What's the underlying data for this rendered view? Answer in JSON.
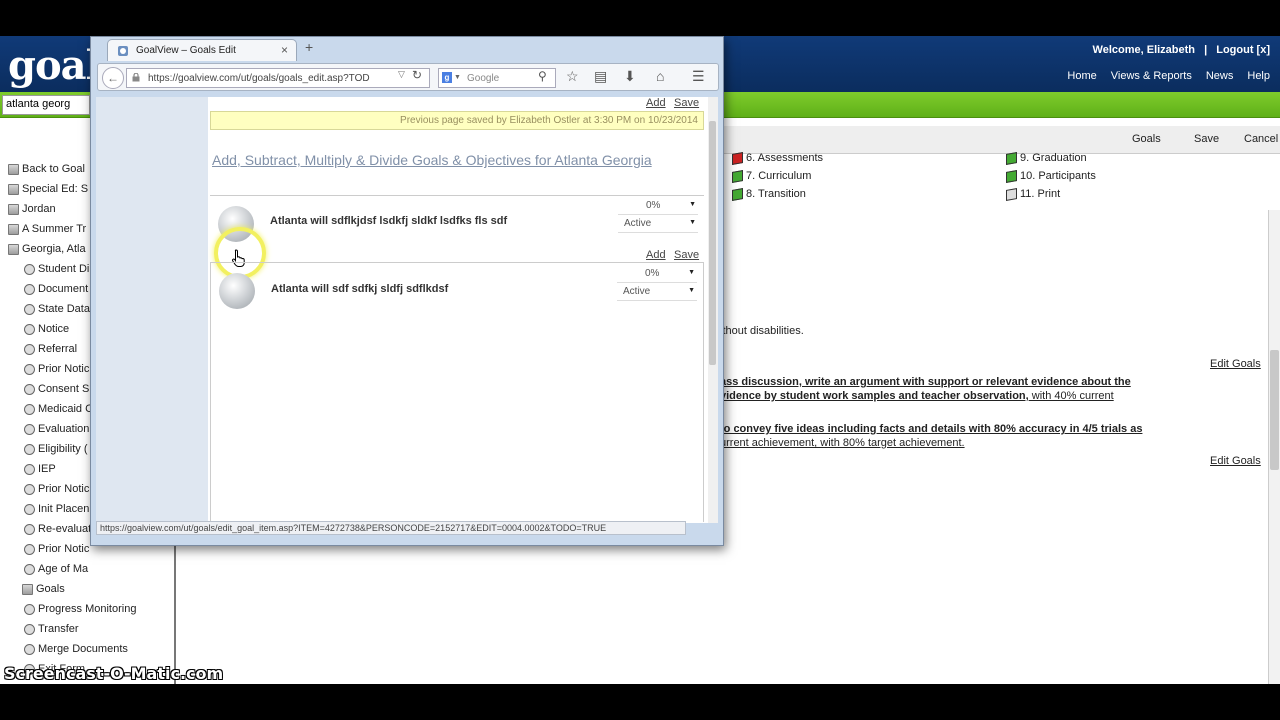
{
  "app": {
    "logo_text": "goal",
    "welcome": "Welcome, Elizabeth",
    "separator": "|",
    "logout": "Logout [x]",
    "nav": [
      "Home",
      "Views & Reports",
      "News",
      "Help"
    ],
    "search_value": "atlanta georg",
    "toolbar": {
      "goals": "Goals",
      "save": "Save",
      "cancel": "Cancel"
    }
  },
  "sidebar": {
    "items": [
      {
        "label": "Back to Goal",
        "icon": "folder"
      },
      {
        "label": "Special Ed: S",
        "icon": "folder"
      },
      {
        "label": "Jordan",
        "icon": "folder"
      },
      {
        "label": "A Summer Tr",
        "icon": "folder"
      },
      {
        "label": "Georgia, Atla",
        "icon": "folder"
      },
      {
        "label": "Student Di",
        "icon": "circle"
      },
      {
        "label": "Document",
        "icon": "circle"
      },
      {
        "label": "State Data",
        "icon": "circle"
      },
      {
        "label": "Notice",
        "icon": "circle"
      },
      {
        "label": "Referral",
        "icon": "circle"
      },
      {
        "label": "Prior Notic",
        "icon": "circle"
      },
      {
        "label": "Consent S",
        "icon": "circle"
      },
      {
        "label": "Medicaid C",
        "icon": "circle"
      },
      {
        "label": "Evaluation",
        "icon": "circle"
      },
      {
        "label": "Eligibility (",
        "icon": "circle"
      },
      {
        "label": "IEP",
        "icon": "circle"
      },
      {
        "label": "Prior Notic",
        "icon": "circle"
      },
      {
        "label": "Init Placen",
        "icon": "circle"
      },
      {
        "label": "Re-evaluat",
        "icon": "circle"
      },
      {
        "label": "Prior Notic",
        "icon": "circle"
      },
      {
        "label": "Age of Ma",
        "icon": "circle"
      },
      {
        "label": "Goals",
        "icon": "folder"
      },
      {
        "label": "Progress Monitoring",
        "icon": "circle"
      },
      {
        "label": "Transfer",
        "icon": "circle"
      },
      {
        "label": "Merge Documents",
        "icon": "circle"
      },
      {
        "label": "Exit Form",
        "icon": "circle"
      }
    ]
  },
  "status_items": [
    {
      "label": "6. Assessments",
      "color": "#cc2222"
    },
    {
      "label": "7. Curriculum",
      "color": "#44aa33"
    },
    {
      "label": "8. Transition",
      "color": "#44aa33"
    },
    {
      "label": "9. Graduation",
      "color": "#44aa33"
    },
    {
      "label": "10. Participants",
      "color": "#44aa33"
    },
    {
      "label": "11. Print",
      "color": "#dddddd"
    }
  ],
  "background_text": {
    "line1": "ithout disabilities.",
    "goal1_a": "ass discussion, write an argument with support or relevant evidence about the",
    "goal1_b": "vidence by student work samples and teacher observation,",
    "goal1_c": " with 40% current",
    "goal2_a": "to convey five ideas including facts and details with 80% accuracy in 4/5 trials as",
    "goal2_b": "urrent achievement, with 80% target achievement.",
    "edit_goals": "Edit Goals"
  },
  "popup": {
    "tab_title": "GoalView – Goals Edit",
    "tab_close": "×",
    "new_tab": "+",
    "url": "https://goalview.com/ut/goals/goals_edit.asp?TOD",
    "search_placeholder": "Google",
    "add": "Add",
    "save": "Save",
    "saved_banner": "Previous page saved by Elizabeth Ostler at 3:30 PM on 10/23/2014",
    "title": "Add, Subtract, Multiply & Divide Goals & Objectives for Atlanta Georgia",
    "goals": [
      {
        "text": "Atlanta will sdflkjdsf lsdkfj sldkf lsdfks fls sdf",
        "percent": "0%",
        "status": "Active"
      },
      {
        "text": "Atlanta will sdf sdfkj sldfj sdflkdsf",
        "percent": "0%",
        "status": "Active"
      }
    ],
    "status_url": "https://goalview.com/ut/goals/edit_goal_item.asp?ITEM=4272738&PERSONCODE=2152717&EDIT=0004.0002&TODO=TRUE"
  },
  "watermark": "Screencast-O-Matic.com"
}
